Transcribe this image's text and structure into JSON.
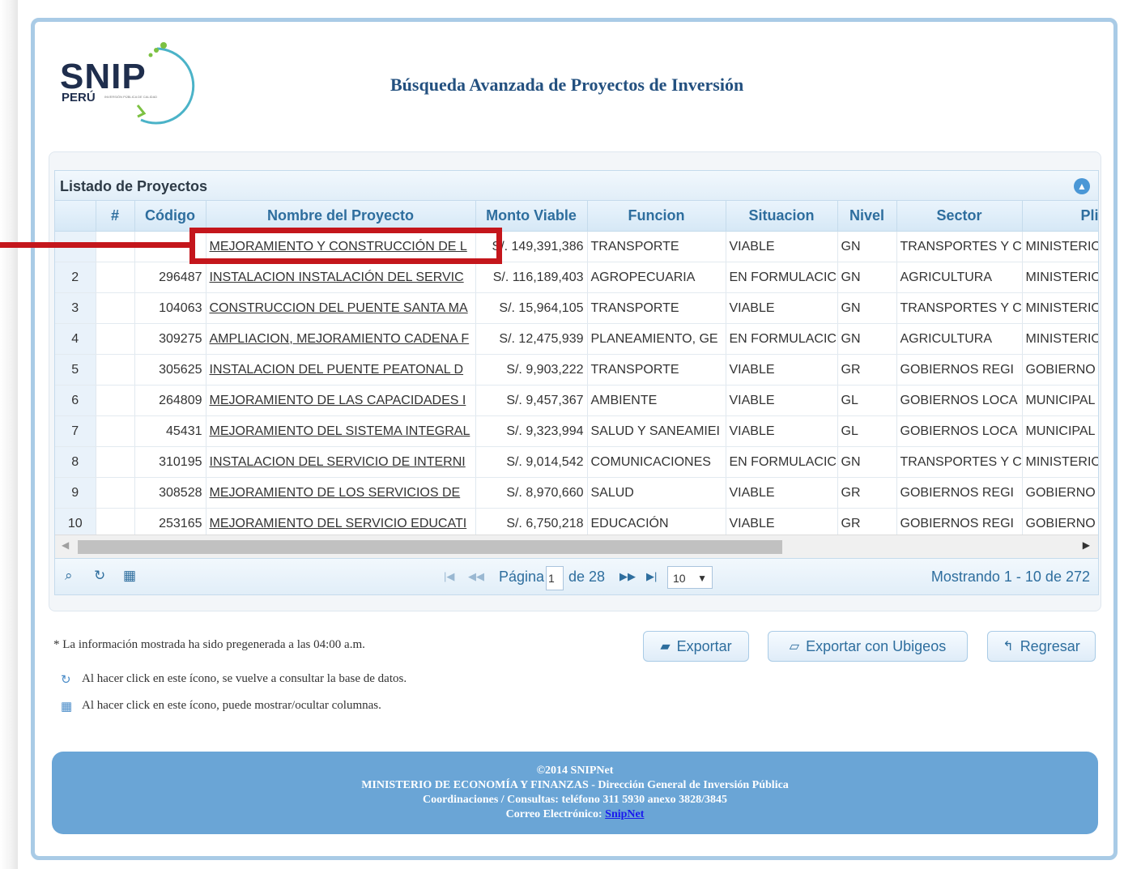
{
  "header": {
    "logo_text": "SNIP",
    "logo_subtext": "PERÚ",
    "logo_tagline": "INVERSIÓN PÚBLICA DE CALIDAD",
    "title": "Búsqueda Avanzada de Proyectos de Inversión"
  },
  "grid": {
    "caption": "Listado de Proyectos",
    "columns": [
      "",
      "#",
      "Código",
      "Nombre del Proyecto",
      "Monto Viable",
      "Funcion",
      "Situacion",
      "Nivel",
      "Sector",
      "Plieg"
    ],
    "rows": [
      {
        "n": "",
        "codigo": "",
        "nombre": "MEJORAMIENTO Y CONSTRUCCIÓN DE L",
        "monto": "S/. 149,391,386",
        "funcion": "TRANSPORTE",
        "situacion": "VIABLE",
        "nivel": "GN",
        "sector": "TRANSPORTES Y C",
        "pliego": "MINISTERIO"
      },
      {
        "n": "2",
        "codigo": "296487",
        "nombre": "INSTALACION INSTALACIÓN DEL SERVIC",
        "monto": "S/. 116,189,403",
        "funcion": "AGROPECUARIA",
        "situacion": "EN FORMULACIC",
        "nivel": "GN",
        "sector": "AGRICULTURA",
        "pliego": "MINISTERIO"
      },
      {
        "n": "3",
        "codigo": "104063",
        "nombre": "CONSTRUCCION DEL PUENTE SANTA MA",
        "monto": "S/. 15,964,105",
        "funcion": "TRANSPORTE",
        "situacion": "VIABLE",
        "nivel": "GN",
        "sector": "TRANSPORTES Y C",
        "pliego": "MINISTERIO"
      },
      {
        "n": "4",
        "codigo": "309275",
        "nombre": "AMPLIACION, MEJORAMIENTO CADENA F",
        "monto": "S/. 12,475,939",
        "funcion": "PLANEAMIENTO, GE",
        "situacion": "EN FORMULACIC",
        "nivel": "GN",
        "sector": "AGRICULTURA",
        "pliego": "MINISTERIO"
      },
      {
        "n": "5",
        "codigo": "305625",
        "nombre": "INSTALACION DEL PUENTE PEATONAL D",
        "monto": "S/. 9,903,222",
        "funcion": "TRANSPORTE",
        "situacion": "VIABLE",
        "nivel": "GR",
        "sector": "GOBIERNOS REGI",
        "pliego": "GOBIERNO"
      },
      {
        "n": "6",
        "codigo": "264809",
        "nombre": "MEJORAMIENTO DE LAS CAPACIDADES I",
        "monto": "S/. 9,457,367",
        "funcion": "AMBIENTE",
        "situacion": "VIABLE",
        "nivel": "GL",
        "sector": "GOBIERNOS LOCA",
        "pliego": "MUNICIPAL"
      },
      {
        "n": "7",
        "codigo": "45431",
        "nombre": "MEJORAMIENTO DEL SISTEMA INTEGRAL",
        "monto": "S/. 9,323,994",
        "funcion": "SALUD Y SANEAMIEI",
        "situacion": "VIABLE",
        "nivel": "GL",
        "sector": "GOBIERNOS LOCA",
        "pliego": "MUNICIPAL"
      },
      {
        "n": "8",
        "codigo": "310195",
        "nombre": "INSTALACION DEL SERVICIO DE INTERNI",
        "monto": "S/. 9,014,542",
        "funcion": "COMUNICACIONES",
        "situacion": "EN FORMULACIC",
        "nivel": "GN",
        "sector": "TRANSPORTES Y C",
        "pliego": "MINISTERIO"
      },
      {
        "n": "9",
        "codigo": "308528",
        "nombre": "MEJORAMIENTO DE LOS SERVICIOS DE",
        "monto": "S/. 8,970,660",
        "funcion": "SALUD",
        "situacion": "VIABLE",
        "nivel": "GR",
        "sector": "GOBIERNOS REGI",
        "pliego": "GOBIERNO"
      },
      {
        "n": "10",
        "codigo": "253165",
        "nombre": "MEJORAMIENTO DEL SERVICIO EDUCATI",
        "monto": "S/. 6,750,218",
        "funcion": "EDUCACIÓN",
        "situacion": "VIABLE",
        "nivel": "GR",
        "sector": "GOBIERNOS REGI",
        "pliego": "GOBIERNO"
      }
    ]
  },
  "pager": {
    "page_label": "Página",
    "page_value": "1",
    "of_label": "de 28",
    "rows_per_page": "10",
    "records": "Mostrando 1 - 10 de 272"
  },
  "notes": {
    "pregenerated": "* La información mostrada ha sido pregenerada a las 04:00 a.m.",
    "refresh_hint": "Al hacer click en este ícono, se vuelve a consultar la base de datos.",
    "columns_hint": "Al hacer click en este ícono, puede mostrar/ocultar columnas."
  },
  "buttons": {
    "exportar": "Exportar",
    "exportar_ubigeos": "Exportar con Ubigeos",
    "regresar": "Regresar"
  },
  "footer": {
    "line1": "©2014 SNIPNet",
    "line2": "MINISTERIO DE ECONOMÍA Y FINANZAS - Dirección General de Inversión Pública",
    "line3": "Coordinaciones / Consultas: teléfono 311 5930 anexo 3828/3845",
    "email_label": "Correo Electrónico:",
    "email_link": "SnipNet"
  },
  "colors": {
    "highlight": "#c4161c",
    "header_text": "#2e6e9e",
    "footer_bg": "#6aa5d6"
  }
}
